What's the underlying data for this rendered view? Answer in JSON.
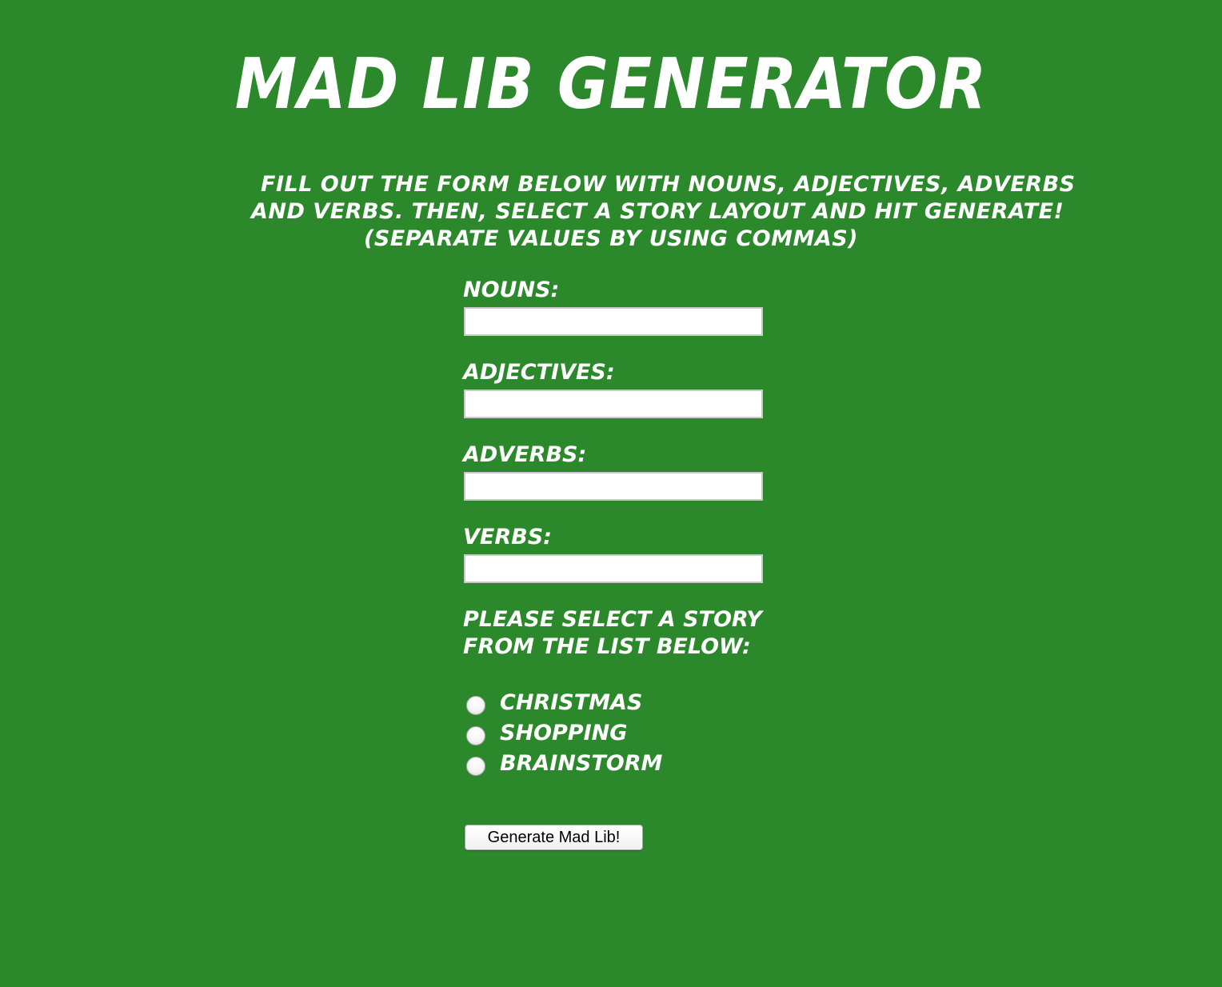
{
  "page": {
    "title": "Mad Lib Generator",
    "background_color": "#2b882b",
    "text_color": "#ffffff"
  },
  "intro": {
    "line1": "Fill out the form below with nouns, adjectives, adverbs",
    "line2": "and verbs. Then, select a story layout and hit generate!",
    "line3": "(Separate values by using commas)"
  },
  "form": {
    "fields": [
      {
        "label": "Nouns:",
        "value": "",
        "placeholder": ""
      },
      {
        "label": "Adjectives:",
        "value": "",
        "placeholder": ""
      },
      {
        "label": "Adverbs:",
        "value": "",
        "placeholder": ""
      },
      {
        "label": "Verbs:",
        "value": "",
        "placeholder": ""
      }
    ],
    "story_prompt": {
      "line1": "Please select a story",
      "line2": "from the list below:"
    },
    "stories": [
      {
        "label": "Christmas",
        "checked": false
      },
      {
        "label": "Shopping",
        "checked": false
      },
      {
        "label": "Brainstorm",
        "checked": false
      }
    ],
    "submit_label": "Generate Mad Lib!"
  }
}
